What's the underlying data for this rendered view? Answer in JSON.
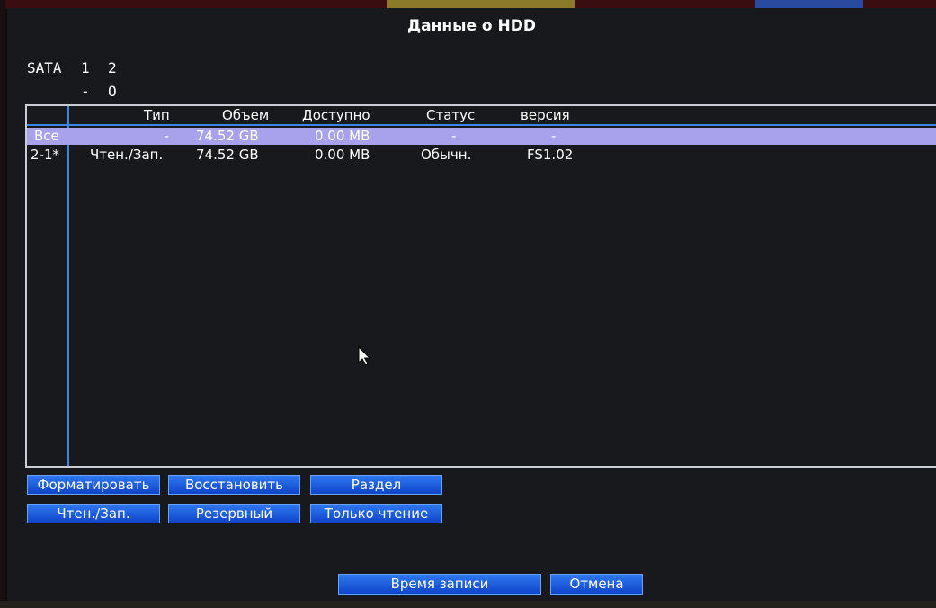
{
  "window": {
    "title": "Данные о HDD"
  },
  "sata": {
    "label": "SATA",
    "ports": [
      "1",
      "2"
    ],
    "states": [
      "-",
      "O"
    ]
  },
  "table": {
    "headers": [
      "",
      "Тип",
      "Объем",
      "Доступно",
      "Статус",
      "версия"
    ],
    "rows": [
      {
        "id": "Все",
        "type": "-",
        "size": "74.52 GB",
        "free": "0.00 MB",
        "status": "-",
        "version": "-"
      },
      {
        "id": "2-1*",
        "type": "Чтен./Зап.",
        "size": "74.52 GB",
        "free": "0.00 MB",
        "status": "Обычн.",
        "version": "FS1.02"
      }
    ]
  },
  "buttons": {
    "format": "Форматировать",
    "restore": "Восстановить",
    "partition": "Раздел",
    "rw": "Чтен./Зап.",
    "backup": "Резервный",
    "readonly": "Только чтение",
    "record_time": "Время записи",
    "cancel": "Отмена"
  },
  "colors": {
    "selected_row": "#a8a2ec",
    "button": "#1f5fe0",
    "grid_line": "#3c86e6"
  }
}
